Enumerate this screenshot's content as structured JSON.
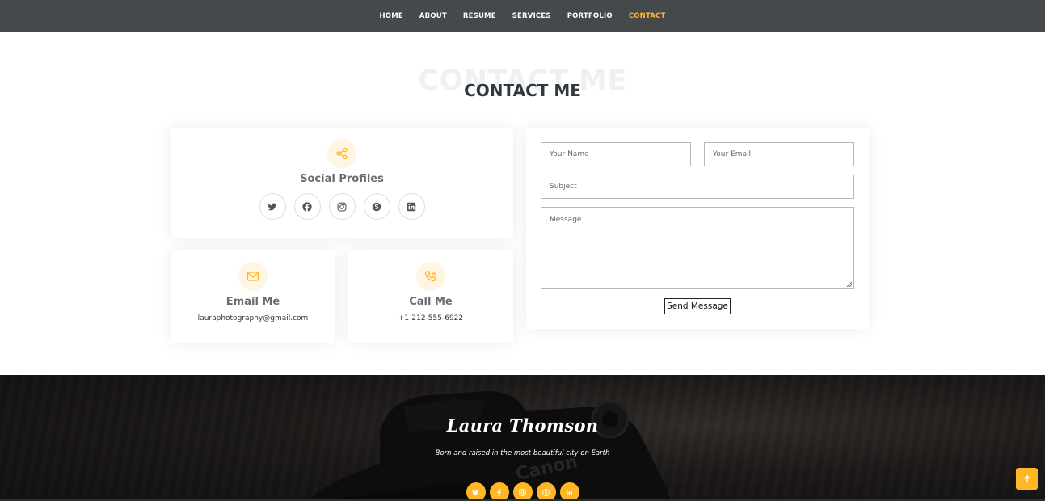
{
  "nav": {
    "items": [
      {
        "label": "HOME"
      },
      {
        "label": "ABOUT"
      },
      {
        "label": "RESUME"
      },
      {
        "label": "SERVICES"
      },
      {
        "label": "PORTFOLIO"
      },
      {
        "label": "CONTACT",
        "active": true
      }
    ],
    "active_color": "#ffb727"
  },
  "section": {
    "title_ghost": "CONTACT ME",
    "title": "CONTACT ME"
  },
  "social": {
    "title": "Social Profiles",
    "icons": [
      "twitter-icon",
      "facebook-icon",
      "instagram-icon",
      "skype-icon",
      "linkedin-icon"
    ]
  },
  "email": {
    "title": "Email Me",
    "value": "lauraphotography@gmail.com",
    "icon": "envelope-icon"
  },
  "call": {
    "title": "Call Me",
    "value": "+1-212-555-6922",
    "icon": "phone-icon"
  },
  "form": {
    "name_placeholder": "Your Name",
    "email_placeholder": "Your Email",
    "subject_placeholder": "Subject",
    "message_placeholder": "Message",
    "submit_label": "Send Message"
  },
  "footer": {
    "name": "Laura Thomson",
    "tagline": "Born and raised in the most beautiful city on Earth",
    "icons": [
      "twitter-icon",
      "facebook-icon",
      "instagram-icon",
      "skype-icon",
      "linkedin-icon"
    ]
  },
  "colors": {
    "accent": "#ffb727",
    "nav_bg": "#45494c",
    "heading": "#2f3a3e"
  }
}
